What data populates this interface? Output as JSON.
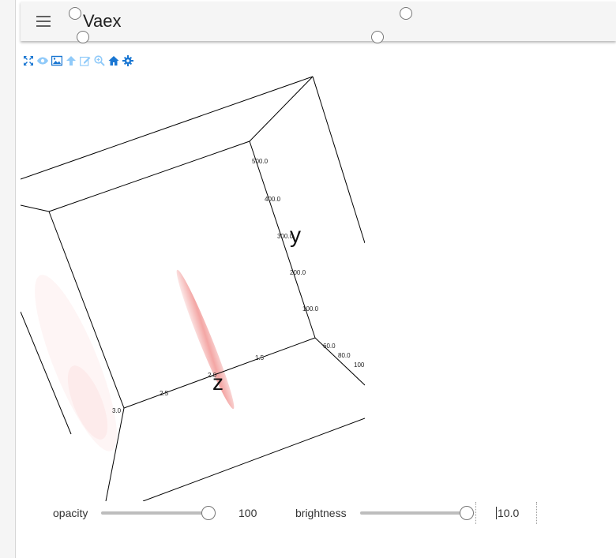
{
  "app": {
    "title": "Vaex"
  },
  "toolbar": {
    "tools": [
      {
        "icon": "fullscreen-icon",
        "color": "#1976d2"
      },
      {
        "icon": "eye-icon",
        "color": "#90caf9"
      },
      {
        "icon": "image-icon",
        "color": "#1976d2"
      },
      {
        "icon": "arrow-up-icon",
        "color": "#90caf9"
      },
      {
        "icon": "edit-icon",
        "color": "#90caf9"
      },
      {
        "icon": "zoom-icon",
        "color": "#90caf9"
      },
      {
        "icon": "home-icon",
        "color": "#1976d2"
      },
      {
        "icon": "gear-icon",
        "color": "#1976d2"
      }
    ]
  },
  "plot": {
    "axis_labels": {
      "y": "y",
      "z": "z"
    },
    "y_ticks": [
      "500.0",
      "400.0",
      "300.0",
      "200.0",
      "100.0"
    ],
    "z_ticks": [
      "3.0",
      "2.5",
      "2.0",
      "1.5"
    ],
    "x_ticks": [
      "60.0",
      "80.0",
      "100"
    ]
  },
  "controls": {
    "opacity": {
      "label": "opacity",
      "value": "100",
      "fraction": 1.0
    },
    "brightness": {
      "label": "brightness",
      "value": "10.0",
      "fraction": 1.0
    }
  },
  "colors": {
    "accent": "#1976d2",
    "accent_light": "#90caf9",
    "point_cloud": "#e53935"
  }
}
